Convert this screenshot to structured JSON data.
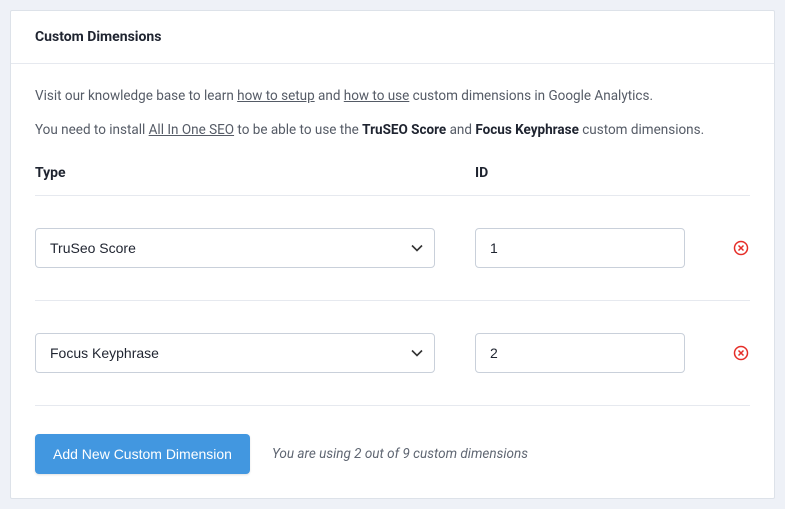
{
  "panel": {
    "title": "Custom Dimensions"
  },
  "intro": {
    "part1": "Visit our knowledge base to learn ",
    "link1": "how to setup",
    "part2": " and ",
    "link2": "how to use",
    "part3": " custom dimensions in Google Analytics."
  },
  "install_note": {
    "part1": "You need to install ",
    "link": "All In One SEO",
    "part2": " to be able to use the ",
    "bold1": "TruSEO Score",
    "part3": " and ",
    "bold2": "Focus Keyphrase",
    "part4": " custom dimensions."
  },
  "columns": {
    "type": "Type",
    "id": "ID"
  },
  "rows": [
    {
      "type_label": "TruSeo Score",
      "id_value": "1"
    },
    {
      "type_label": "Focus Keyphrase",
      "id_value": "2"
    }
  ],
  "footer": {
    "add_label": "Add New Custom Dimension",
    "usage": "You are using 2 out of 9 custom dimensions"
  }
}
